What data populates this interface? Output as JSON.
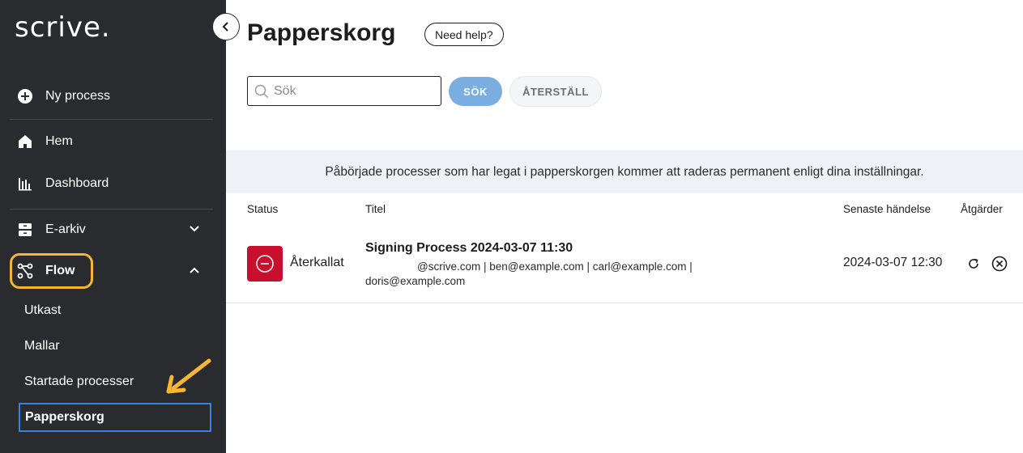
{
  "sidebar": {
    "logo": "scrive.",
    "new_process": "Ny process",
    "items": {
      "home": "Hem",
      "dashboard": "Dashboard",
      "earchive": "E-arkiv",
      "flow": "Flow"
    },
    "flow_sub": {
      "drafts": "Utkast",
      "templates": "Mallar",
      "started": "Startade processer",
      "trash": "Papperskorg"
    },
    "highlight_color": "#f6b532"
  },
  "header": {
    "title": "Papperskorg",
    "help_label": "Need help?"
  },
  "search": {
    "placeholder": "Sök",
    "search_button": "SÖK",
    "reset_button": "ÅTERSTÄLL"
  },
  "notice": "Påbörjade processer som har legat i papperskorgen kommer att raderas permanent enligt dina inställningar.",
  "table": {
    "columns": {
      "status": "Status",
      "title": "Titel",
      "last_event": "Senaste händelse",
      "actions": "Åtgärder"
    },
    "rows": [
      {
        "status": "Återkallat",
        "status_color": "#c8102e",
        "title": "Signing Process 2024-03-07 11:30",
        "parties_line1": "@scrive.com | ben@example.com | carl@example.com |",
        "parties_line2": "doris@example.com",
        "last_event": "2024-03-07 12:30"
      }
    ]
  },
  "colors": {
    "sidebar_bg": "#2a2b2e",
    "primary_button": "#7aaee0",
    "notice_bg": "#eef2f6",
    "active_border": "#3b82d6"
  }
}
